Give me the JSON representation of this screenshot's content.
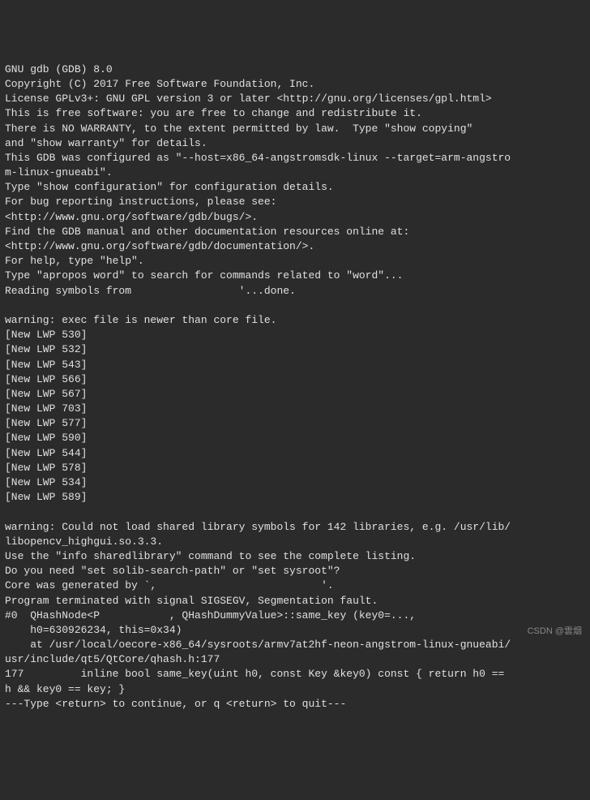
{
  "terminal": {
    "lines": [
      "GNU gdb (GDB) 8.0",
      "Copyright (C) 2017 Free Software Foundation, Inc.",
      "License GPLv3+: GNU GPL version 3 or later <http://gnu.org/licenses/gpl.html>",
      "This is free software: you are free to change and redistribute it.",
      "There is NO WARRANTY, to the extent permitted by law.  Type \"show copying\"",
      "and \"show warranty\" for details.",
      "This GDB was configured as \"--host=x86_64-angstromsdk-linux --target=arm-angstro",
      "m-linux-gnueabi\".",
      "Type \"show configuration\" for configuration details.",
      "For bug reporting instructions, please see:",
      "<http://www.gnu.org/software/gdb/bugs/>.",
      "Find the GDB manual and other documentation resources online at:",
      "<http://www.gnu.org/software/gdb/documentation/>.",
      "For help, type \"help\".",
      "Type \"apropos word\" to search for commands related to \"word\"...",
      "Reading symbols from                 '...done.",
      "",
      "warning: exec file is newer than core file.",
      "[New LWP 530]",
      "[New LWP 532]",
      "[New LWP 543]",
      "[New LWP 566]",
      "[New LWP 567]",
      "[New LWP 703]",
      "[New LWP 577]",
      "[New LWP 590]",
      "[New LWP 544]",
      "[New LWP 578]",
      "[New LWP 534]",
      "[New LWP 589]",
      "",
      "warning: Could not load shared library symbols for 142 libraries, e.g. /usr/lib/",
      "libopencv_highgui.so.3.3.",
      "Use the \"info sharedlibrary\" command to see the complete listing.",
      "Do you need \"set solib-search-path\" or \"set sysroot\"?",
      "Core was generated by `,                          '.",
      "Program terminated with signal SIGSEGV, Segmentation fault.",
      "#0  QHashNode<P           , QHashDummyValue>::same_key (key0=...,",
      "    h0=630926234, this=0x34)",
      "    at /usr/local/oecore-x86_64/sysroots/armv7at2hf-neon-angstrom-linux-gnueabi/",
      "usr/include/qt5/QtCore/qhash.h:177",
      "177         inline bool same_key(uint h0, const Key &key0) const { return h0 ==",
      "h && key0 == key; }",
      "---Type <return> to continue, or q <return> to quit---"
    ]
  },
  "watermark": "CSDN @雲烟"
}
